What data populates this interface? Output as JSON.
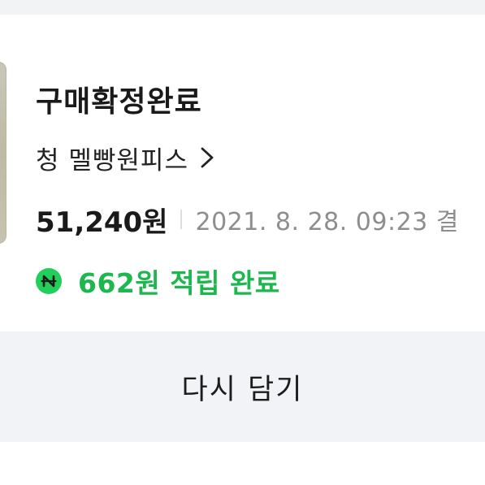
{
  "order": {
    "status": "구매확정완료",
    "product_name": "청 멜빵원피스",
    "price": "51,240원",
    "paid_date": "2021. 8. 28. 09:23 결",
    "points_text": "662원 적립 완료"
  },
  "actions": {
    "rebuy_label": "다시 담기"
  },
  "icons": {
    "chevron": "chevron-right-icon",
    "points": "naver-pay-icon"
  },
  "colors": {
    "points_green": "#1eb64f",
    "naver_pay_green": "#22cf5a",
    "page_background": "#f2f3f5",
    "button_background": "#f1f3f6"
  }
}
